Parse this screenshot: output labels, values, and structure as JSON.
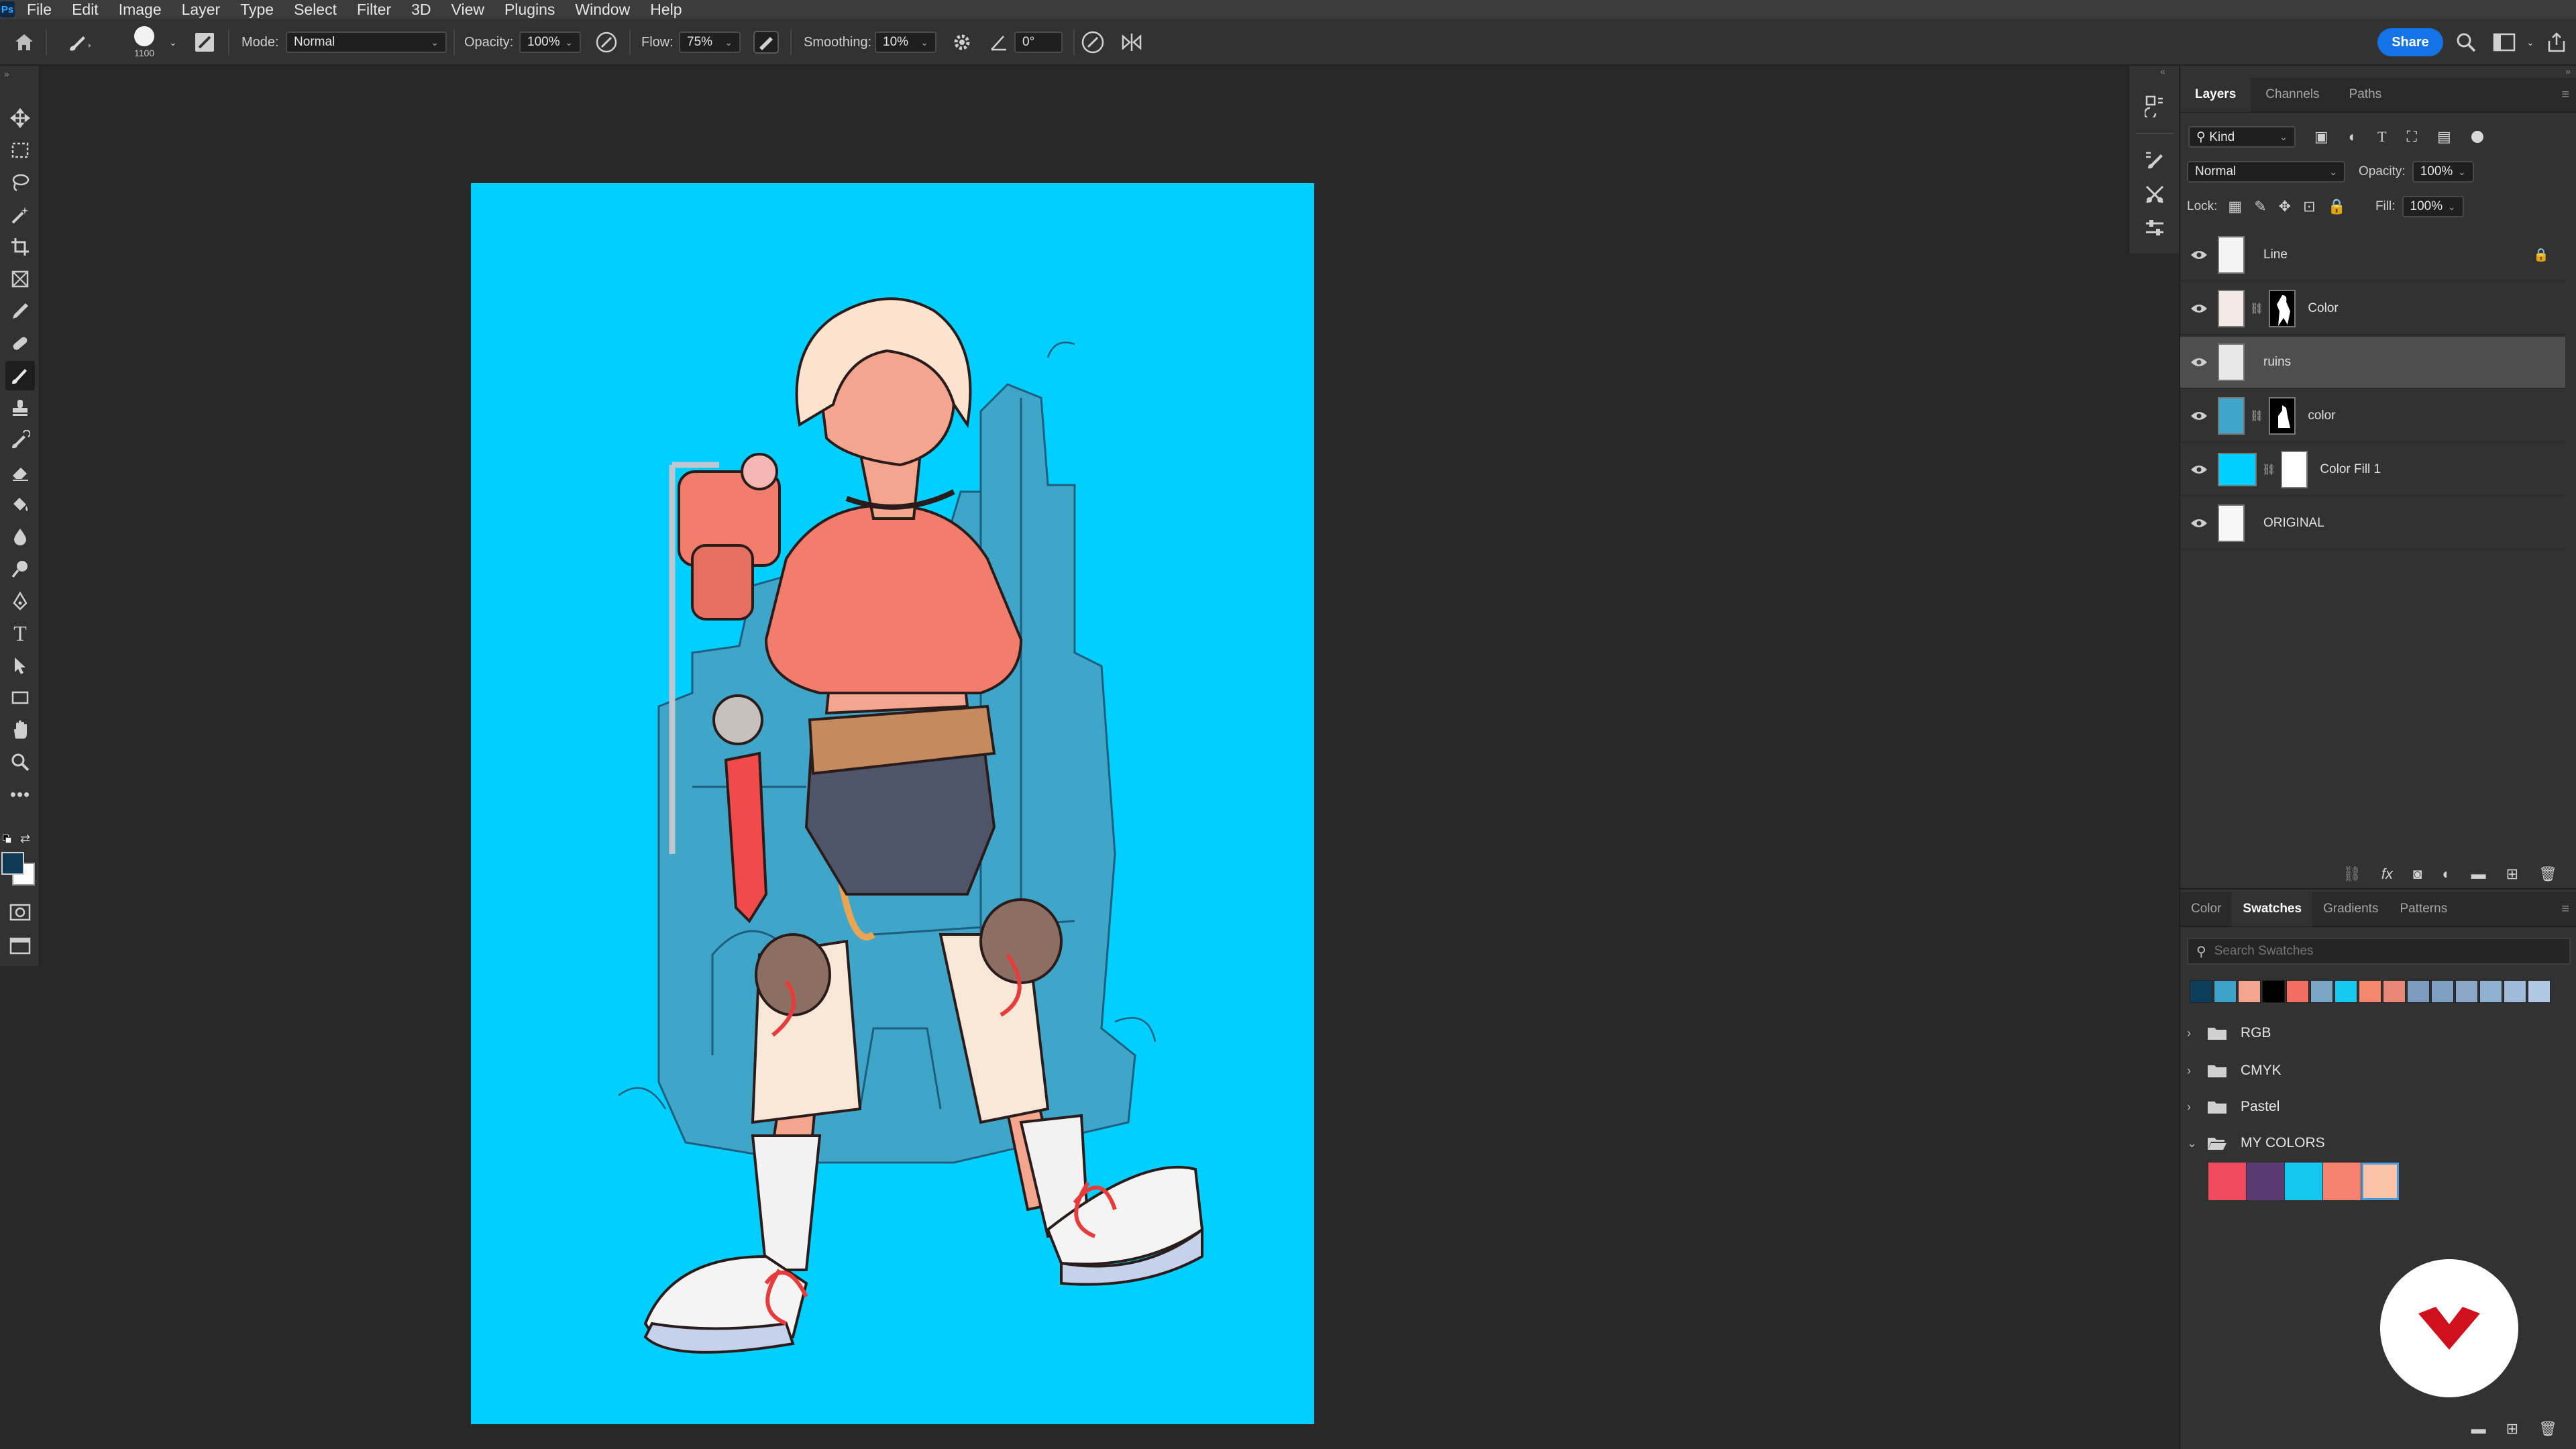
{
  "app": {
    "logo_text": "Ps"
  },
  "menu": [
    "File",
    "Edit",
    "Image",
    "Layer",
    "Type",
    "Select",
    "Filter",
    "3D",
    "View",
    "Plugins",
    "Window",
    "Help"
  ],
  "options": {
    "brush_size": "1100",
    "mode_label": "Mode:",
    "mode_value": "Normal",
    "opacity_label": "Opacity:",
    "opacity_value": "100%",
    "flow_label": "Flow:",
    "flow_value": "75%",
    "smoothing_label": "Smoothing:",
    "smoothing_value": "10%",
    "angle_value": "0°",
    "share_label": "Share"
  },
  "layers_panel": {
    "tabs": [
      "Layers",
      "Channels",
      "Paths"
    ],
    "active_tab": "Layers",
    "filter_kind": "Kind",
    "blend_mode": "Normal",
    "opacity_label": "Opacity:",
    "opacity_value": "100%",
    "lock_label": "Lock:",
    "fill_label": "Fill:",
    "fill_value": "100%",
    "layers": [
      {
        "name": "Line",
        "locked": true,
        "selected": false,
        "thumb": "#f4f4f4",
        "mask": false
      },
      {
        "name": "Color",
        "locked": false,
        "selected": false,
        "thumb": "#f2e8e6",
        "mask": true
      },
      {
        "name": "ruins",
        "locked": false,
        "selected": true,
        "thumb": "#e8e8e8",
        "mask": false
      },
      {
        "name": "color",
        "locked": false,
        "selected": false,
        "thumb": "#3fa6c9",
        "mask": true
      },
      {
        "name": "Color Fill 1",
        "locked": false,
        "selected": false,
        "thumb": "#00cfff",
        "mask": true
      },
      {
        "name": "ORIGINAL",
        "locked": false,
        "selected": false,
        "thumb": "#f7f7f7",
        "mask": false
      }
    ]
  },
  "swatches_panel": {
    "tabs": [
      "Color",
      "Swatches",
      "Gradients",
      "Patterns"
    ],
    "active_tab": "Swatches",
    "search_placeholder": "Search Swatches",
    "recent_colors": [
      "#0c3d5a",
      "#3ea3c8",
      "#f4a58d",
      "#000000",
      "#f26d62",
      "#7aa6c5",
      "#16c9ef",
      "#f5876f",
      "#e88776",
      "#7d9bbd",
      "#7f9fc0",
      "#8aa7c7",
      "#8fb0d0",
      "#9fbbd8",
      "#b0c8e4"
    ],
    "folders": [
      {
        "name": "RGB",
        "expanded": false
      },
      {
        "name": "CMYK",
        "expanded": false
      },
      {
        "name": "Pastel",
        "expanded": false
      },
      {
        "name": "MY COLORS",
        "expanded": true
      }
    ],
    "my_colors": [
      "#f04a5e",
      "#5b3a74",
      "#13c7ef",
      "#f4826f",
      "#fbc4a9"
    ]
  },
  "colors": {
    "canvas_bg": "#00cfff",
    "foreground": "#0d3b56",
    "background": "#ffffff",
    "accent": "#1473e6",
    "brand": "#d0101c"
  }
}
